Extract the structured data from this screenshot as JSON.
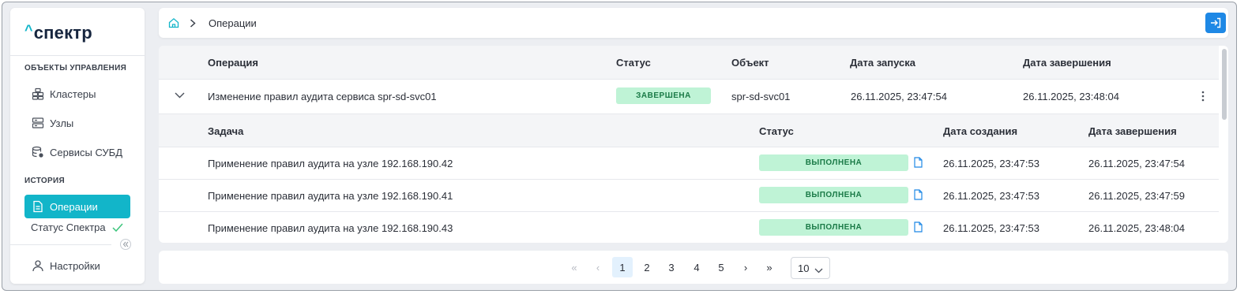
{
  "logo": {
    "caret": "^",
    "text": "спектр"
  },
  "sidebar": {
    "section_objects": "ОБЪЕКТЫ УПРАВЛЕНИЯ",
    "section_history": "ИСТОРИЯ",
    "items": [
      {
        "label": "Кластеры",
        "icon": "clusters-icon"
      },
      {
        "label": "Узлы",
        "icon": "servers-icon"
      },
      {
        "label": "Сервисы СУБД",
        "icon": "database-service-icon"
      },
      {
        "label": "Операции",
        "icon": "document-icon",
        "active": true
      }
    ],
    "status_label": "Статус Спектра",
    "settings_label": "Настройки"
  },
  "breadcrumb": {
    "current": "Операции"
  },
  "operations": {
    "headers": {
      "operation": "Операция",
      "status": "Статус",
      "object": "Объект",
      "started": "Дата запуска",
      "finished": "Дата завершения"
    },
    "row": {
      "name": "Изменение правил аудита сервиса spr-sd-svc01",
      "status": "ЗАВЕРШЕНА",
      "object": "spr-sd-svc01",
      "started": "26.11.2025, 23:47:54",
      "finished": "26.11.2025, 23:48:04"
    }
  },
  "tasks": {
    "headers": {
      "task": "Задача",
      "status": "Статус",
      "created": "Дата создания",
      "finished": "Дата завершения"
    },
    "rows": [
      {
        "name": "Применение правил аудита на узле 192.168.190.42",
        "status": "ВЫПОЛНЕНА",
        "created": "26.11.2025, 23:47:53",
        "finished": "26.11.2025, 23:47:54"
      },
      {
        "name": "Применение правил аудита на узле 192.168.190.41",
        "status": "ВЫПОЛНЕНА",
        "created": "26.11.2025, 23:47:53",
        "finished": "26.11.2025, 23:47:59"
      },
      {
        "name": "Применение правил аудита на узле 192.168.190.43",
        "status": "ВЫПОЛНЕНА",
        "created": "26.11.2025, 23:47:53",
        "finished": "26.11.2025, 23:48:04"
      }
    ]
  },
  "pagination": {
    "first": "«",
    "prev": "‹",
    "pages": [
      "1",
      "2",
      "3",
      "4",
      "5"
    ],
    "current": "1",
    "next": "›",
    "last": "»",
    "page_size": "10"
  },
  "colors": {
    "accent": "#12b5c9",
    "primary_button": "#1e88e5",
    "success_badge_bg": "#bff3d6",
    "success_badge_text": "#1a7a47"
  }
}
